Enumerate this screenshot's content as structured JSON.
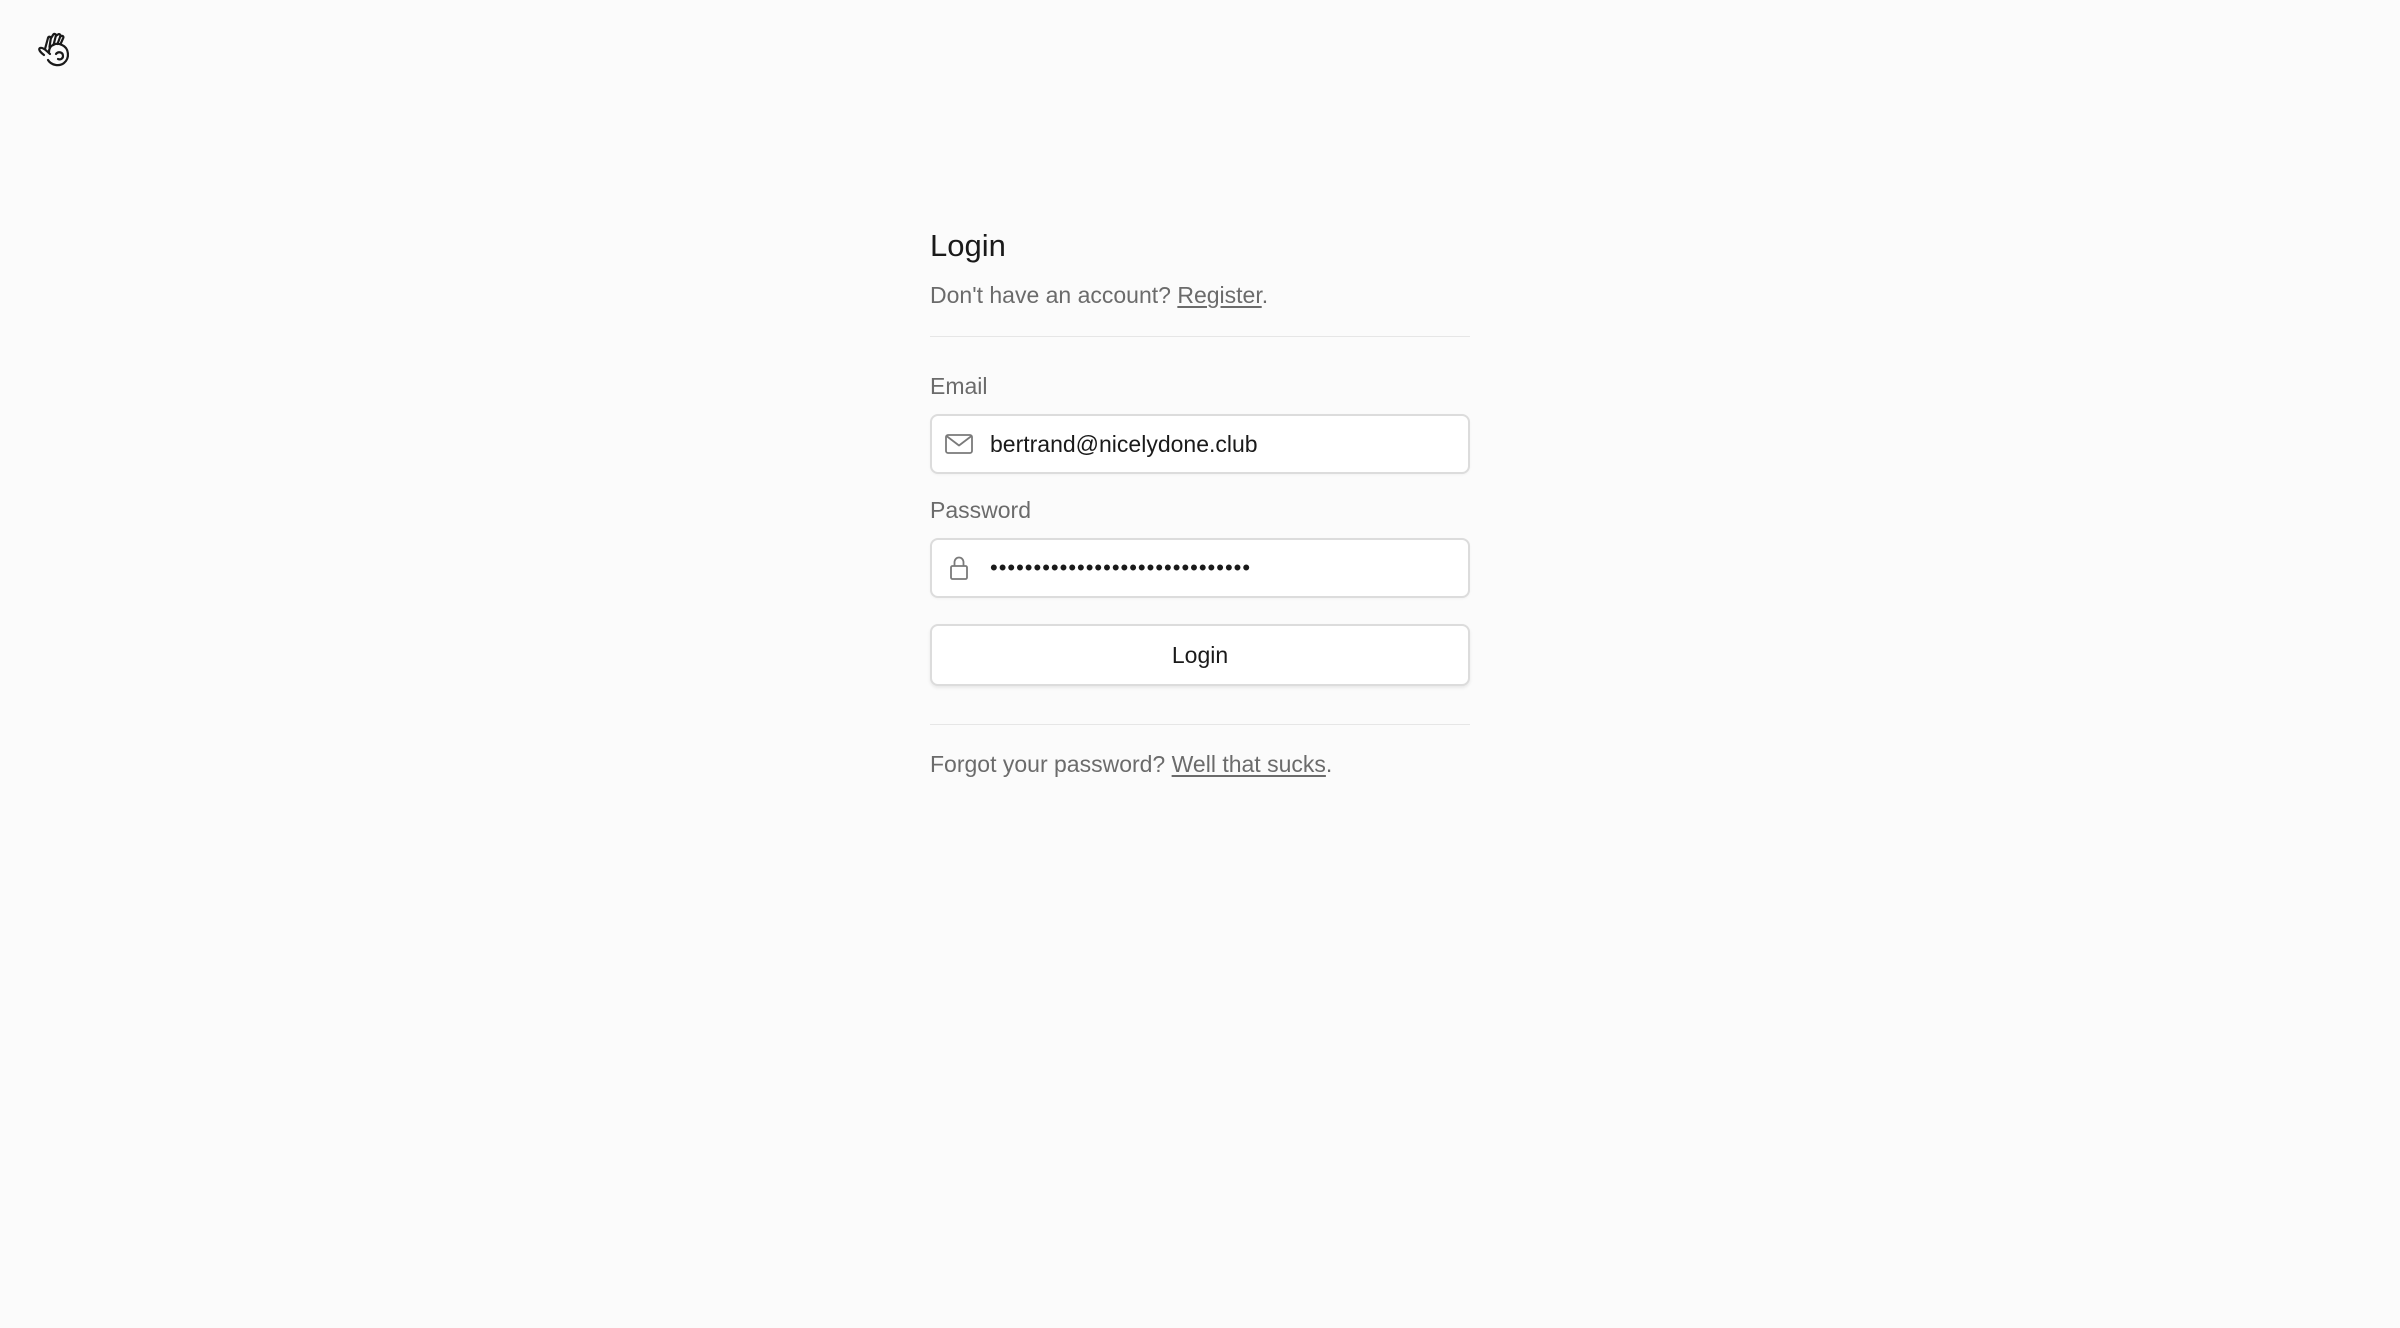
{
  "header": {
    "logo_icon": "hand-wave-icon"
  },
  "login": {
    "title": "Login",
    "subtitle_prefix": "Don't have an account? ",
    "register_link": "Register",
    "subtitle_suffix": ".",
    "email_label": "Email",
    "email_value": "bertrand@nicelydone.club",
    "email_icon": "mail-icon",
    "password_label": "Password",
    "password_value": "••••••••••••••••••••••••••••••",
    "password_icon": "lock-icon",
    "submit_label": "Login",
    "forgot_prefix": "Forgot your password? ",
    "forgot_link": "Well that sucks",
    "forgot_suffix": "."
  },
  "colors": {
    "background": "#fbfbfb",
    "text": "#1a1a1a",
    "muted_text": "#6b6b6b",
    "border": "#dcdcdc"
  }
}
